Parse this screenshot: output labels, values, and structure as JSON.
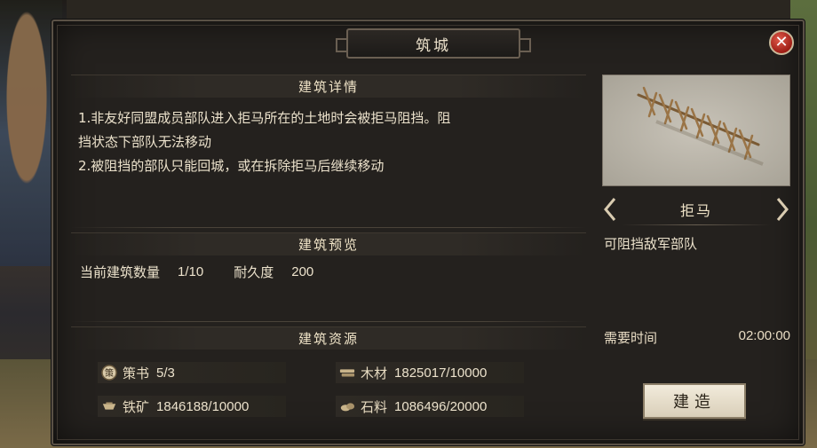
{
  "dialog": {
    "title": "筑城",
    "close_label": "✕"
  },
  "details": {
    "heading": "建筑详情",
    "lines": [
      "1.非友好同盟成员部队进入拒马所在的土地时会被拒马阻挡。阻",
      "挡状态下部队无法移动",
      "2.被阻挡的部队只能回城，或在拆除拒马后继续移动"
    ]
  },
  "preview": {
    "heading": "建筑预览",
    "count_label": "当前建筑数量",
    "count_value": "1/10",
    "durability_label": "耐久度",
    "durability_value": "200"
  },
  "resources": {
    "heading": "建筑资源",
    "items": [
      {
        "label": "策书",
        "value": "5/3",
        "icon": "strategy-book-icon"
      },
      {
        "label": "木材",
        "value": "1825017/10000",
        "icon": "wood-icon"
      },
      {
        "label": "铁矿",
        "value": "1846188/10000",
        "icon": "iron-icon"
      },
      {
        "label": "石料",
        "value": "1086496/20000",
        "icon": "stone-icon"
      }
    ]
  },
  "building": {
    "name": "拒马",
    "effect": "可阻挡敌军部队",
    "time_label": "需要时间",
    "time_value": "02:00:00",
    "build_button": "建造"
  },
  "colors": {
    "panel": "#24211e",
    "accent_text": "#f0e4c8",
    "close_red": "#b52a1f"
  }
}
